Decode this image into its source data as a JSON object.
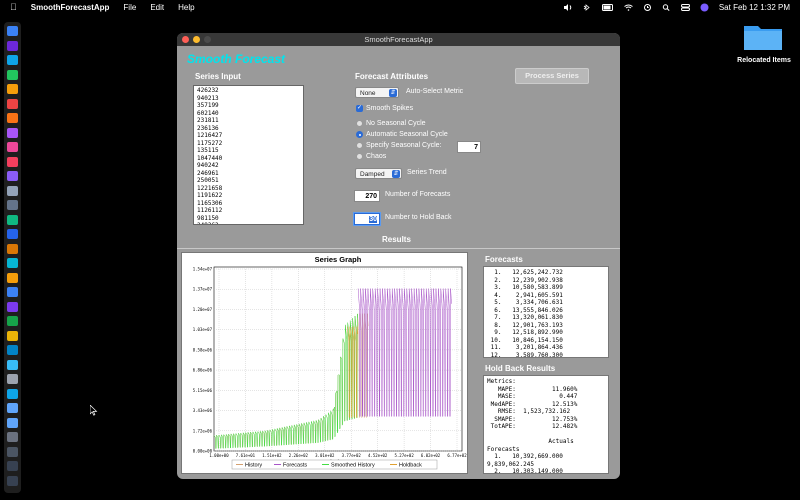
{
  "menubar": {
    "app_name": "SmoothForecastApp",
    "menus": [
      "File",
      "Edit",
      "Help"
    ],
    "datetime": "Sat Feb 12  1:32 PM"
  },
  "desktop": {
    "folder_label": "Relocated Items"
  },
  "window": {
    "title": "SmoothForecastApp",
    "app_heading": "Smooth Forecast",
    "series_input_label": "Series Input",
    "series_values": [
      "426232",
      "940213",
      "357199",
      "602140",
      "231811",
      "236136",
      "1216427",
      "1175272",
      "135115",
      "1047440",
      "940242",
      "246961",
      "250051",
      "1221658",
      "1191622",
      "1165306",
      "1126112",
      "981150",
      "249363"
    ],
    "forecast_attributes_label": "Forecast Attributes",
    "process_button": "Process Series",
    "metric_select": "None",
    "metric_label": "Auto-Select Metric",
    "smooth_spikes": {
      "label": "Smooth Spikes",
      "checked": true
    },
    "seasonal": {
      "options": [
        "No Seasonal Cycle",
        "Automatic Seasonal Cycle",
        "Specify Seasonal Cycle:",
        "Chaos"
      ],
      "selected": 1,
      "cycle_value": "7"
    },
    "trend_select": "Damped",
    "trend_label": "Series Trend",
    "num_forecasts": {
      "value": "270",
      "label": "Number of Forecasts"
    },
    "hold_back": {
      "value": "30",
      "label": "Number to Hold Back"
    },
    "results_label": "Results",
    "forecasts_label": "Forecasts",
    "forecasts_list": [
      "  1.   12,625,242.732",
      "  2.   12,239,902.938",
      "  3.   10,580,583.899",
      "  4.    2,941,605.591",
      "  5.    3,334,706.631",
      "  6.   13,555,846.026",
      "  7.   13,320,061.830",
      "  8.   12,901,763.193",
      "  9.   12,518,892.990",
      " 10.   10,846,154.150",
      " 11.    3,201,864.436",
      " 12.    3,589,760.300",
      " 13.   13,805,798.6.."
    ],
    "holdback_label": "Hold Back Results",
    "holdback_list": [
      "Metrics:",
      "   MAPE:          11.960%",
      "   MASE:            0.447",
      " MedAPE:          12.513%",
      "   RMSE:  1,523,732.162",
      "  SMAPE:          12.753%",
      " TotAPE:          12.482%",
      "",
      "                 Actuals",
      "Forecasts",
      "  1.   10,392,669.000",
      "9,839,062.245",
      "  2.   10,303,149.000",
      "9,683,145.596"
    ]
  },
  "chart_data": {
    "type": "line",
    "title": "Series Graph",
    "xlabel": "Index",
    "ylabel": "",
    "x_ticks": [
      "1.00e+00",
      "7.61e+01",
      "1.51e+02",
      "2.26e+02",
      "3.01e+02",
      "3.77e+02",
      "4.52e+02",
      "5.27e+02",
      "6.02e+02",
      "6.77e+02"
    ],
    "y_ticks": [
      "0.00e+00",
      "1.72e+06",
      "3.43e+06",
      "5.15e+06",
      "6.86e+06",
      "8.58e+06",
      "1.03e+07",
      "1.20e+07",
      "1.37e+07",
      "1.54e+07"
    ],
    "xlim": [
      1,
      715
    ],
    "ylim": [
      0,
      15400000
    ],
    "grid": true,
    "legend_position": "bottom",
    "series": [
      {
        "name": "History",
        "color": "#d4a070",
        "x_range": [
          1,
          445
        ],
        "pattern": "oscillating, matches smoothed history"
      },
      {
        "name": "Forecasts",
        "color": "#a855c8",
        "x_range": [
          416,
          685
        ],
        "low": 2900000,
        "high": 13600000
      },
      {
        "name": "Smoothed History",
        "color": "#44dd44",
        "x_range": [
          1,
          415
        ],
        "levels": [
          {
            "x": 1,
            "low": 200000,
            "high": 1300000
          },
          {
            "x": 151,
            "low": 400000,
            "high": 1700000
          },
          {
            "x": 301,
            "low": 700000,
            "high": 2600000
          },
          {
            "x": 345,
            "low": 1000000,
            "high": 3500000
          },
          {
            "x": 377,
            "low": 2500000,
            "high": 10500000
          },
          {
            "x": 415,
            "low": 2800000,
            "high": 11500000
          }
        ]
      },
      {
        "name": "Holdback",
        "color": "#e0a030",
        "x_range": [
          385,
          415
        ],
        "low": 2800000,
        "high": 10400000
      }
    ]
  }
}
